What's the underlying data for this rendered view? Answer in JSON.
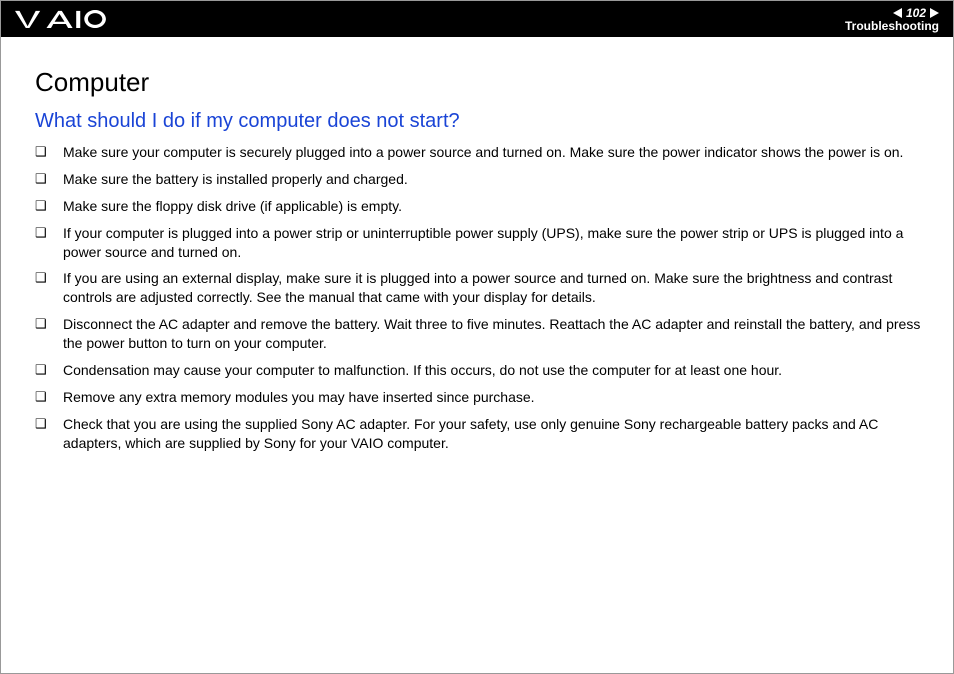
{
  "header": {
    "page_number": "102",
    "section": "Troubleshooting"
  },
  "content": {
    "title": "Computer",
    "question": "What should I do if my computer does not start?",
    "bullets": [
      "Make sure your computer is securely plugged into a power source and turned on. Make sure the power indicator shows the power is on.",
      "Make sure the battery is installed properly and charged.",
      "Make sure the floppy disk drive (if applicable) is empty.",
      "If your computer is plugged into a power strip or uninterruptible power supply (UPS), make sure the power strip or UPS is plugged into a power source and turned on.",
      "If you are using an external display, make sure it is plugged into a power source and turned on. Make sure the brightness and contrast controls are adjusted correctly. See the manual that came with your display for details.",
      "Disconnect the AC adapter and remove the battery. Wait three to five minutes. Reattach the AC adapter and reinstall the battery, and press the power button to turn on your computer.",
      "Condensation may cause your computer to malfunction. If this occurs, do not use the computer for at least one hour.",
      "Remove any extra memory modules you may have inserted since purchase.",
      "Check that you are using the supplied Sony AC adapter. For your safety, use only genuine Sony rechargeable battery packs and AC adapters, which are supplied by Sony for your VAIO computer."
    ]
  }
}
